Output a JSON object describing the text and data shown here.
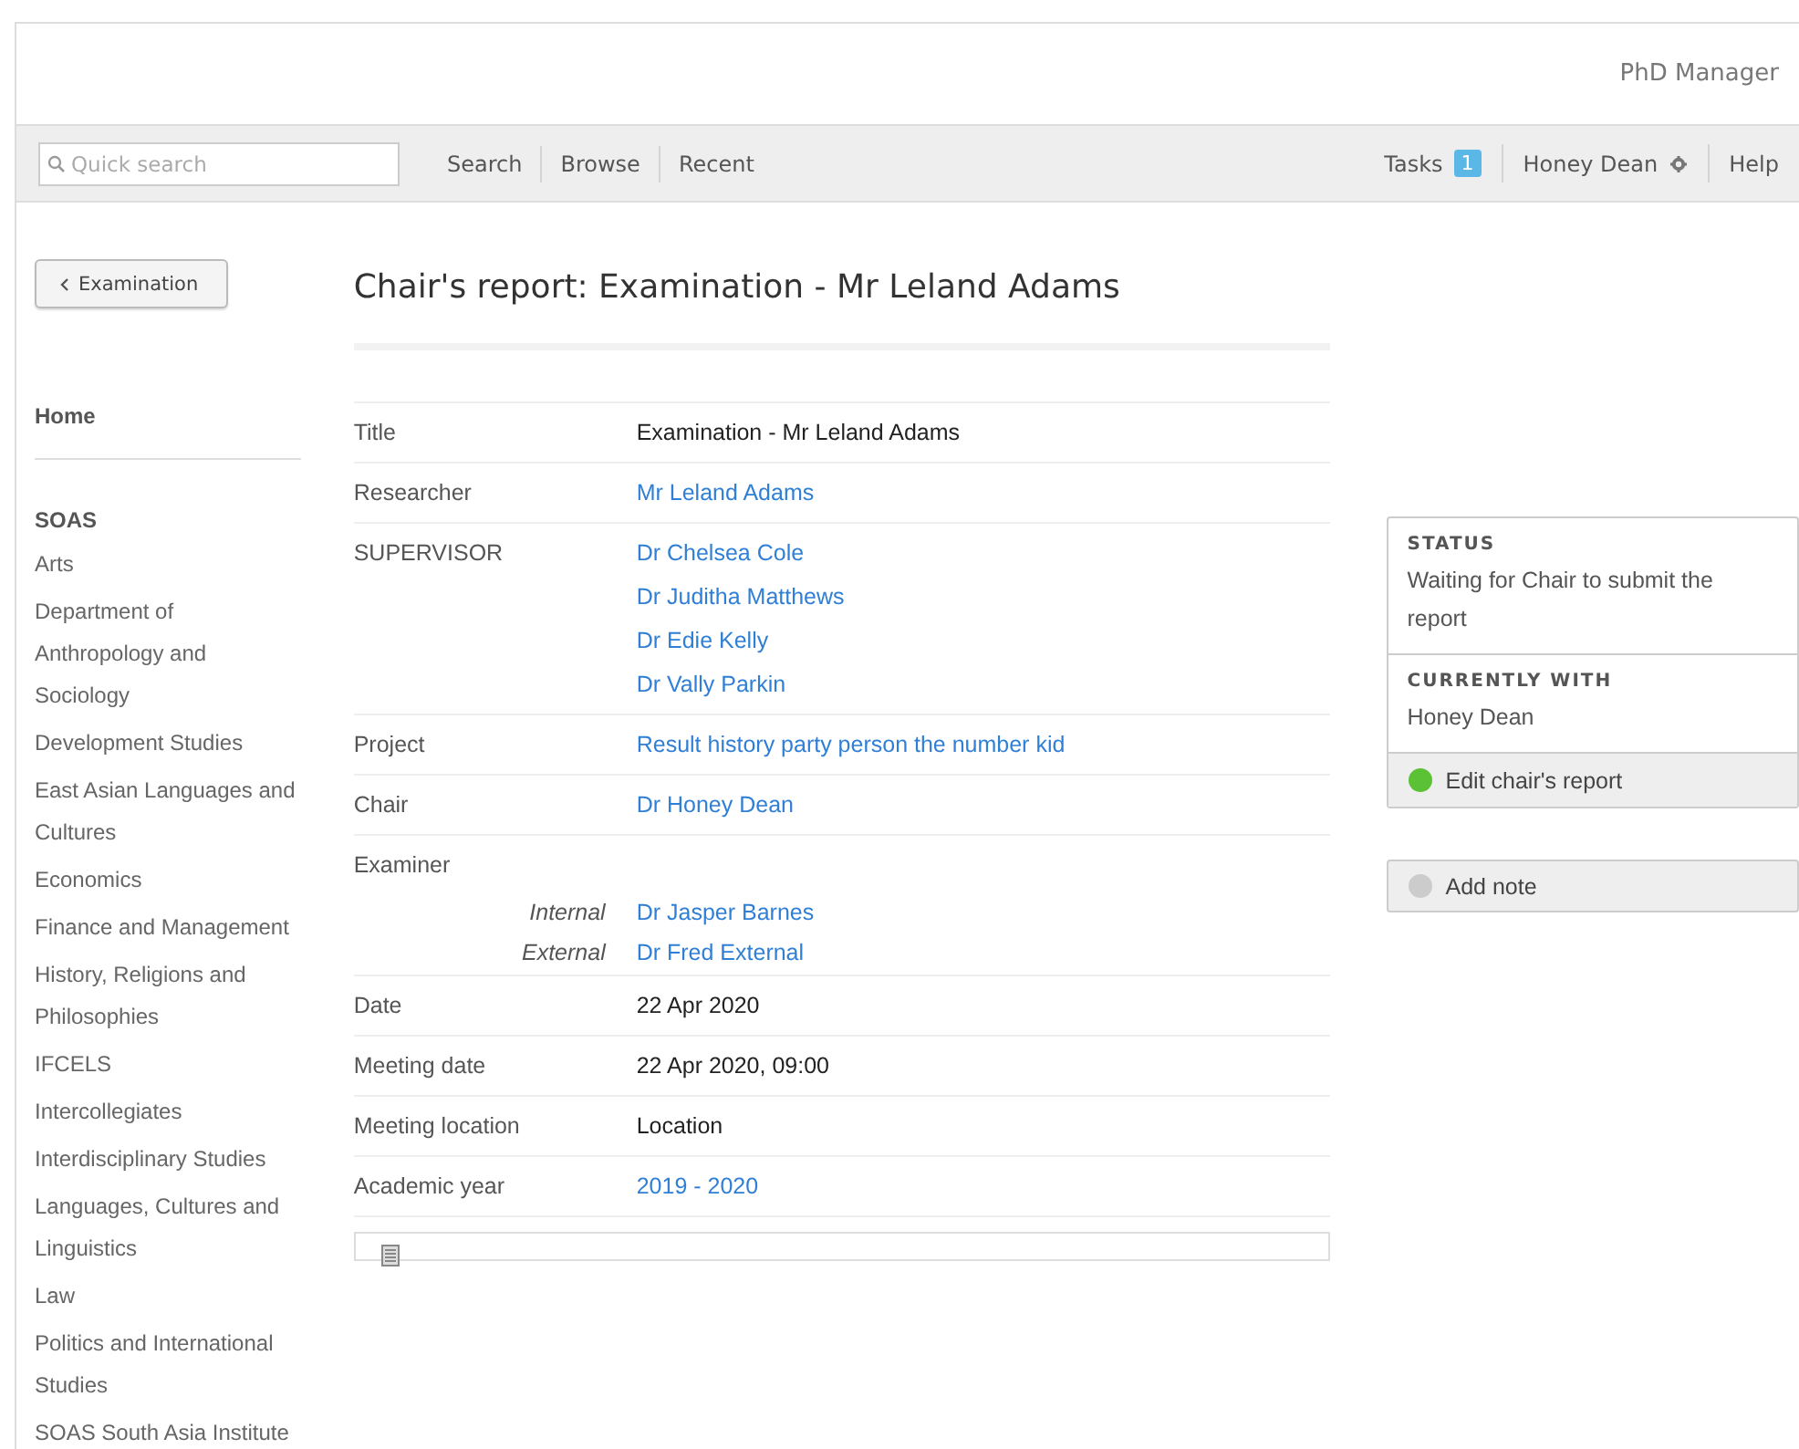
{
  "app_title": "PhD Manager",
  "nav": {
    "search_placeholder": "Quick search",
    "links": [
      "Search",
      "Browse",
      "Recent"
    ],
    "tasks": {
      "label": "Tasks",
      "count": "1"
    },
    "user": "Honey Dean",
    "help": "Help"
  },
  "back_button": "Examination",
  "page_title": "Chair's report: Examination - Mr Leland Adams",
  "sidebar": {
    "home": "Home",
    "section": "SOAS",
    "items": [
      "Arts",
      "Department of Anthropology and Sociology",
      "Development Studies",
      "East Asian Languages and Cultures",
      "Economics",
      "Finance and Management",
      "History, Religions and Philosophies",
      "IFCELS",
      "Intercollegiates",
      "Interdisciplinary Studies",
      "Languages, Cultures and Linguistics",
      "Law",
      "Politics and International Studies",
      "SOAS South Asia Institute"
    ]
  },
  "details": [
    {
      "label": "Title",
      "values": [
        {
          "text": "Examination - Mr Leland Adams",
          "link": false
        }
      ]
    },
    {
      "label": "Researcher",
      "values": [
        {
          "text": "Mr Leland Adams",
          "link": true
        }
      ]
    },
    {
      "label": "SUPERVISOR",
      "values": [
        {
          "text": "Dr Chelsea Cole",
          "link": true
        },
        {
          "text": "Dr Juditha Matthews",
          "link": true
        },
        {
          "text": "Dr Edie Kelly",
          "link": true
        },
        {
          "text": "Dr Vally Parkin",
          "link": true
        }
      ]
    },
    {
      "label": "Project",
      "values": [
        {
          "text": "Result history party person the number kid",
          "link": true
        }
      ]
    },
    {
      "label": "Chair",
      "values": [
        {
          "text": "Dr Honey Dean",
          "link": true
        }
      ]
    },
    {
      "label": "Examiner",
      "values": [
        {
          "role": "Internal",
          "text": "Dr Jasper Barnes",
          "link": true
        },
        {
          "role": "External",
          "text": "Dr Fred External",
          "link": true
        }
      ]
    },
    {
      "label": "Date",
      "values": [
        {
          "text": "22 Apr 2020",
          "link": false
        }
      ]
    },
    {
      "label": "Meeting date",
      "values": [
        {
          "text": "22 Apr 2020, 09:00",
          "link": false
        }
      ]
    },
    {
      "label": "Meeting location",
      "values": [
        {
          "text": "Location",
          "link": false
        }
      ]
    },
    {
      "label": "Academic year",
      "values": [
        {
          "text": "2019 - 2020",
          "link": true
        }
      ]
    }
  ],
  "status_panel": {
    "status_heading": "STATUS",
    "status": "Waiting for Chair to submit the report",
    "with_heading": "CURRENTLY WITH",
    "with": "Honey Dean",
    "action": {
      "label": "Edit chair's report",
      "color": "#5bc236"
    }
  },
  "note_button": {
    "label": "Add note",
    "color": "#cccccc"
  }
}
